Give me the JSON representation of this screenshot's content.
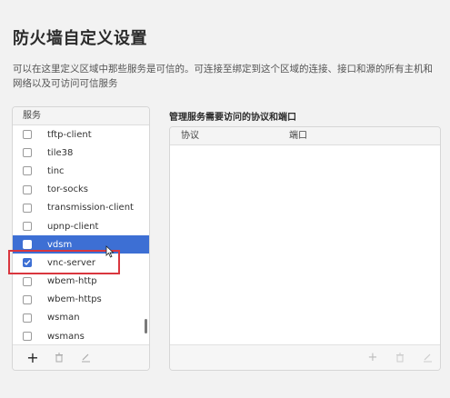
{
  "dialog": {
    "title": "防火墙自定义设置",
    "description": "可以在这里定义区域中那些服务是可信的。可连接至绑定到这个区域的连接、接口和源的所有主机和网络以及可访问可信服务"
  },
  "services": {
    "header": "服务",
    "items": [
      {
        "label": "tftp-client",
        "checked": false,
        "selected": false
      },
      {
        "label": "tile38",
        "checked": false,
        "selected": false
      },
      {
        "label": "tinc",
        "checked": false,
        "selected": false
      },
      {
        "label": "tor-socks",
        "checked": false,
        "selected": false
      },
      {
        "label": "transmission-client",
        "checked": false,
        "selected": false
      },
      {
        "label": "upnp-client",
        "checked": false,
        "selected": false
      },
      {
        "label": "vdsm",
        "checked": false,
        "selected": true
      },
      {
        "label": "vnc-server",
        "checked": true,
        "selected": false
      },
      {
        "label": "wbem-http",
        "checked": false,
        "selected": false
      },
      {
        "label": "wbem-https",
        "checked": false,
        "selected": false
      },
      {
        "label": "wsman",
        "checked": false,
        "selected": false
      },
      {
        "label": "wsmans",
        "checked": false,
        "selected": false
      }
    ],
    "footer": {
      "add_icon": "+",
      "remove_icon": "trash-icon",
      "edit_icon": "edit-icon"
    }
  },
  "ports": {
    "title": "管理服务需要访问的协议和端口",
    "columns": {
      "protocol": "协议",
      "port": "端口"
    },
    "rows": [],
    "footer": {
      "add_icon": "+",
      "remove_icon": "trash-icon",
      "edit_icon": "edit-icon"
    }
  },
  "colors": {
    "selection": "#3d6fd4",
    "highlight_box": "#d9363e"
  }
}
